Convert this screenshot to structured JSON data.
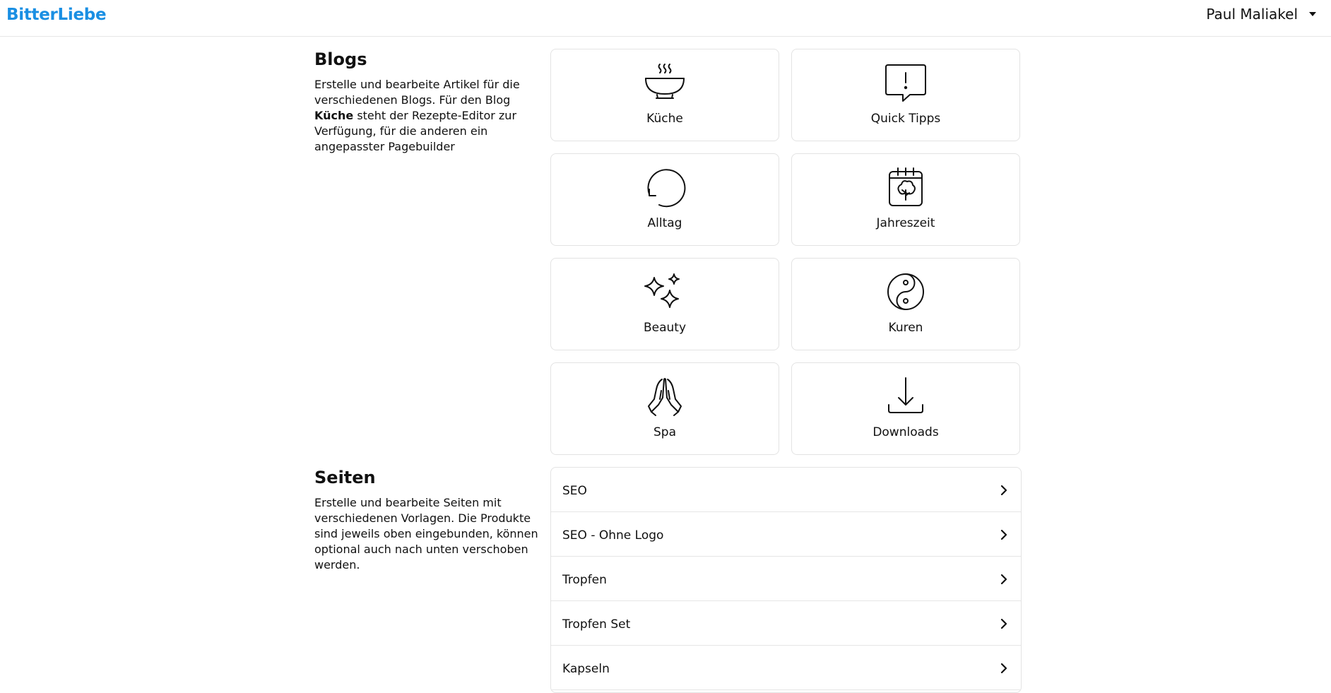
{
  "header": {
    "logo": "BitterLiebe",
    "user_name": "Paul Maliakel"
  },
  "blogs": {
    "title": "Blogs",
    "desc_part1": "Erstelle und bearbeite Artikel für die verschiedenen Blogs. Für den Blog ",
    "desc_bold": "Küche",
    "desc_part2": " steht der Rezepte-Editor zur Verfügung, für die anderen ein angepasster Pagebuilder",
    "cards": [
      {
        "label": "Küche",
        "icon": "bowl-steam-icon"
      },
      {
        "label": "Quick Tipps",
        "icon": "chat-alert-icon"
      },
      {
        "label": "Alltag",
        "icon": "refresh-icon"
      },
      {
        "label": "Jahreszeit",
        "icon": "calendar-tree-icon"
      },
      {
        "label": "Beauty",
        "icon": "sparkles-icon"
      },
      {
        "label": "Kuren",
        "icon": "yin-yang-icon"
      },
      {
        "label": "Spa",
        "icon": "praying-hands-icon"
      },
      {
        "label": "Downloads",
        "icon": "download-icon"
      }
    ]
  },
  "seiten": {
    "title": "Seiten",
    "desc": "Erstelle und bearbeite Seiten mit verschiedenen Vorlagen. Die Produkte sind jeweils oben eingebunden, können optional auch nach unten verschoben werden.",
    "items": [
      {
        "label": "SEO"
      },
      {
        "label": "SEO - Ohne Logo"
      },
      {
        "label": "Tropfen"
      },
      {
        "label": "Tropfen Set"
      },
      {
        "label": "Kapseln"
      }
    ]
  }
}
